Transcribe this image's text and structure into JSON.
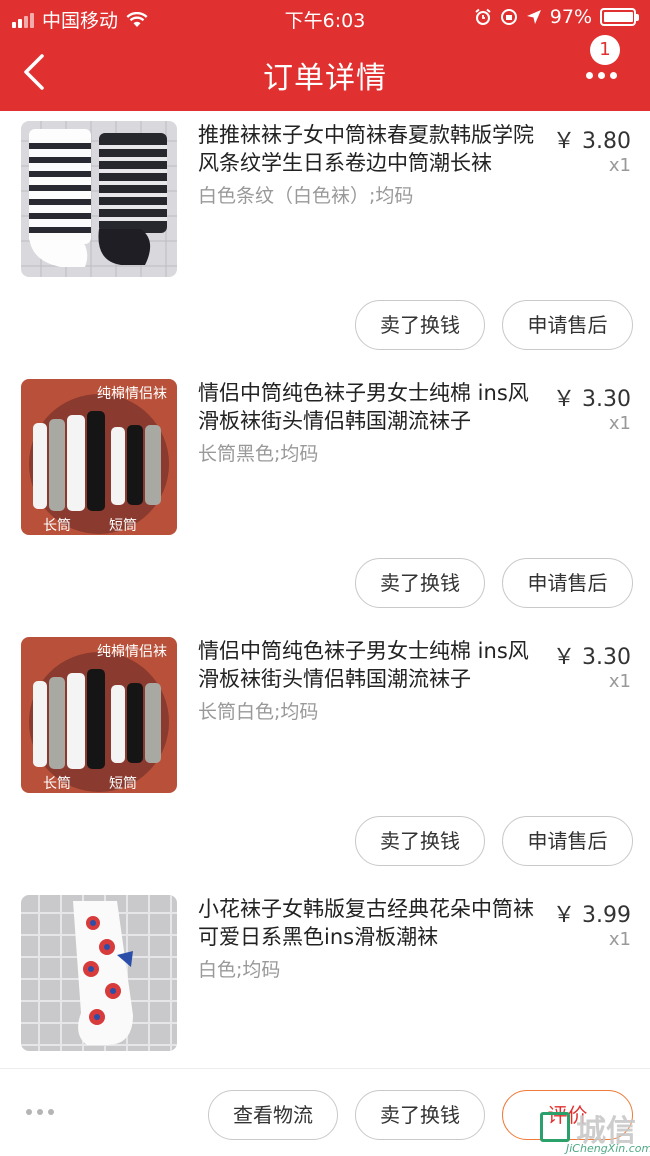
{
  "status_bar": {
    "carrier": "中国移动",
    "time": "下午6:03",
    "battery": "97%",
    "battery_level": 0.97
  },
  "nav": {
    "title": "订单详情",
    "badge": "1",
    "icons": {
      "back": "chevron-left-icon",
      "more": "more-dots-icon"
    }
  },
  "items": [
    {
      "title": "推推袜袜子女中筒袜春夏款韩版学院风条纹学生日系卷边中筒潮长袜",
      "spec": "白色条纹（白色袜）;均码",
      "price": "￥ 3.80",
      "qty": "x1",
      "sell_label": "卖了换钱",
      "aftersale_label": "申请售后"
    },
    {
      "title": "情侣中筒纯色袜子男女士纯棉 ins风滑板袜街头情侣韩国潮流袜子",
      "spec": "长筒黑色;均码",
      "price": "￥ 3.30",
      "qty": "x1",
      "thumb_caption": "纯棉情侣袜",
      "thumb_label_left": "长筒",
      "thumb_label_right": "短筒",
      "sell_label": "卖了换钱",
      "aftersale_label": "申请售后"
    },
    {
      "title": "情侣中筒纯色袜子男女士纯棉 ins风滑板袜街头情侣韩国潮流袜子",
      "spec": "长筒白色;均码",
      "price": "￥ 3.30",
      "qty": "x1",
      "thumb_caption": "纯棉情侣袜",
      "thumb_label_left": "长筒",
      "thumb_label_right": "短筒",
      "sell_label": "卖了换钱",
      "aftersale_label": "申请售后"
    },
    {
      "title": "小花袜子女韩版复古经典花朵中筒袜可爱日系黑色ins滑板潮袜",
      "spec": "白色;均码",
      "price": "￥ 3.99",
      "qty": "x1"
    }
  ],
  "bottom_bar": {
    "logistics_label": "查看物流",
    "sell_label": "卖了换钱",
    "review_label": "评价"
  },
  "watermark": {
    "text": "城信",
    "sub": "JiChengXin.com"
  },
  "colors": {
    "header": "#e0302f",
    "accent": "#e0302f",
    "review_border": "#f07a3a"
  }
}
